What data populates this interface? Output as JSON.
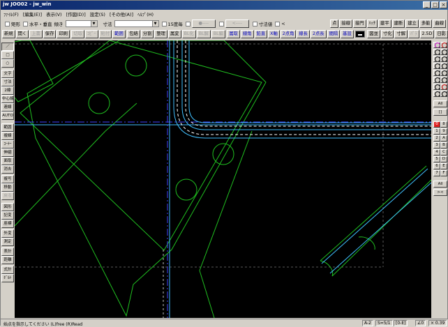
{
  "window": {
    "title": "jw JOO02 - jw_win",
    "controls": [
      "_",
      "□",
      "×"
    ]
  },
  "menu": [
    "ﾌｧｲﾙ(F)",
    "[編集(E)]",
    "表示(V)",
    "[作図(D)]",
    "設定(S)",
    "[その他(A)]",
    "ﾍﾙﾌﾟ(H)"
  ],
  "toolbar1": {
    "rect_label": "矩形",
    "horiz_vert_label": "水平・垂直",
    "tilt_label": "傾き",
    "tilt_value": "",
    "dim_label": "寸法",
    "dim_value": "",
    "deg15_label": "15度毎",
    "arrow1": "●----",
    "arrow2": "<----",
    "dimval_label": "寸法値",
    "lt_label": "<",
    "right_buttons": [
      "点",
      "接線",
      "接円",
      "ﾊｯﾁ",
      "建平",
      "建断",
      "建立",
      "多能",
      "曲線"
    ]
  },
  "toolbar2": {
    "buttons": [
      {
        "label": "新規",
        "dis": false
      },
      {
        "label": "開く",
        "dis": false
      },
      {
        "label": "上書",
        "dis": true
      },
      {
        "label": "保存",
        "dis": false
      },
      {
        "label": "印刷",
        "dis": false
      },
      {
        "label": "切取",
        "dis": true
      },
      {
        "label": "ｺﾋﾟｰ",
        "dis": true
      },
      {
        "label": "貼付",
        "dis": true
      },
      {
        "label": "範囲",
        "dis": false,
        "blue": true
      },
      {
        "label": "包絡",
        "dis": false
      },
      {
        "label": "分割",
        "dis": false
      },
      {
        "label": "整理",
        "dis": false
      },
      {
        "label": "属変",
        "dis": false
      },
      {
        "label": "BL化",
        "dis": true
      },
      {
        "label": "BL解",
        "dis": true
      },
      {
        "label": "BL編",
        "dis": true
      },
      {
        "label": "属取",
        "dis": false,
        "blue": true
      },
      {
        "label": "線角",
        "dis": false,
        "blue": true
      },
      {
        "label": "鉛直",
        "dis": false,
        "blue": true
      },
      {
        "label": "X軸",
        "dis": false,
        "blue": true
      },
      {
        "label": "2点角",
        "dis": false,
        "blue": true
      },
      {
        "label": "線長",
        "dis": false,
        "blue": true
      },
      {
        "label": "2点長",
        "dis": false,
        "blue": true
      },
      {
        "label": "間隔",
        "dis": false,
        "blue": true
      },
      {
        "label": "基設",
        "dis": false,
        "blue": true
      }
    ],
    "right_buttons": [
      {
        "label": "図並",
        "dis": false
      },
      {
        "label": "寸化",
        "dis": false
      },
      {
        "label": "寸解",
        "dis": false
      },
      {
        "label": "ﾊﾟﾗ",
        "dis": true
      },
      {
        "label": "2.5D",
        "dis": false
      },
      {
        "label": "日影",
        "dis": false
      }
    ]
  },
  "left_tools": [
    {
      "label": "／",
      "sel": true,
      "dis": false
    },
    {
      "label": "□",
      "sel": false,
      "dis": false
    },
    {
      "label": "○",
      "sel": false,
      "dis": false
    },
    {
      "label": "文字",
      "sel": false,
      "dis": false
    },
    {
      "label": "寸法",
      "sel": false,
      "dis": false
    },
    {
      "label": "2線",
      "sel": false,
      "dis": false
    },
    {
      "label": "中心線",
      "sel": false,
      "dis": false
    },
    {
      "label": "連線",
      "sel": false,
      "dis": false
    },
    {
      "label": "AUTO",
      "sel": false,
      "dis": false
    },
    {
      "label": "範囲",
      "sel": false,
      "dis": false
    },
    {
      "label": "複線",
      "sel": false,
      "dis": false
    },
    {
      "label": "ｺｰﾅｰ",
      "sel": false,
      "dis": false
    },
    {
      "label": "伸縮",
      "sel": false,
      "dis": false
    },
    {
      "label": "面取",
      "sel": false,
      "dis": false
    },
    {
      "label": "消去",
      "sel": false,
      "dis": false
    },
    {
      "label": "複写",
      "sel": false,
      "dis": false
    },
    {
      "label": "移動",
      "sel": false,
      "dis": false
    },
    {
      "label": "戻る",
      "sel": false,
      "dis": true
    },
    {
      "label": "図形",
      "sel": false,
      "dis": false
    },
    {
      "label": "記変",
      "sel": false,
      "dis": false
    },
    {
      "label": "座標",
      "sel": false,
      "dis": false
    },
    {
      "label": "外変",
      "sel": false,
      "dis": false
    },
    {
      "label": "測定",
      "sel": false,
      "dis": false
    },
    {
      "label": "表計",
      "sel": false,
      "dis": false
    },
    {
      "label": "距離",
      "sel": false,
      "dis": false
    },
    {
      "label": "式計",
      "sel": false,
      "dis": false
    },
    {
      "label": "ﾎﾞﾙﾄ",
      "sel": false,
      "dis": false
    }
  ],
  "right_tools": {
    "layer_group": [
      "0",
      "1",
      "2",
      "3",
      "4",
      "5",
      "6",
      "7",
      "8",
      "9",
      "A",
      "B",
      "C",
      "D",
      "E",
      "F"
    ],
    "all1": "All",
    "bracket": "[]",
    "layer": [
      "0",
      "1",
      "2",
      "3",
      "4",
      "5",
      "6",
      "7",
      "8",
      "9",
      "A",
      "B",
      "C",
      "D",
      "E",
      "F"
    ],
    "all2": "All",
    "arrows": "><"
  },
  "status": {
    "message": "始点を指示してください (L)free (R)Read",
    "paper": "A-2",
    "scale": "S=5/1",
    "layer": "[0-E]",
    "angle": "∠0",
    "zoom": "× 0.39"
  },
  "colors": {
    "canvas_bg": "#000000",
    "green_line": "#20c020",
    "cyan_line": "#40c0ff",
    "blue_line": "#4040ff",
    "white_line": "#ffffff",
    "gray_dash": "#606060"
  }
}
